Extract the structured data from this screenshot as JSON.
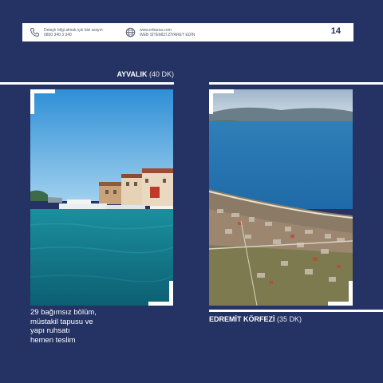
{
  "header": {
    "contact_line1": "Detaylı bilgi almak için bizi arayın",
    "contact_line2": "0850 340 3 340",
    "web_line1": "www.erbarsa.com",
    "web_line2": "WEB SİTEMİZİ ZİYARET EDİN",
    "page_number": "14",
    "phone_icon": "phone-icon",
    "globe_icon": "globe-icon"
  },
  "locations": [
    {
      "name": "AYVALIK",
      "time": "(40 DK)"
    },
    {
      "name": "EDREMİT KÖRFEZİ",
      "time": "(35 DK)"
    }
  ],
  "description_lines": [
    "29 bağımsız bölüm,",
    "müstakil tapusu ve",
    "yapı ruhsatı",
    "hemen teslim"
  ],
  "colors": {
    "background": "#243264",
    "accent": "#ffffff"
  }
}
